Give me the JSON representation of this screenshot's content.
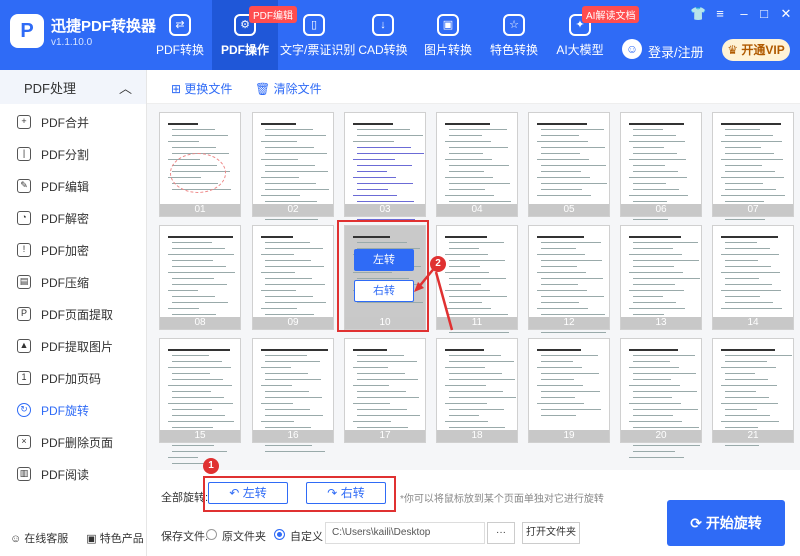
{
  "app": {
    "name": "迅捷PDF转换器",
    "version": "v1.1.10.0",
    "logo_letter": "P"
  },
  "nav": [
    {
      "label": "PDF转换",
      "icon": "convert-icon"
    },
    {
      "label": "PDF操作",
      "icon": "gear-icon",
      "badge": "PDF编辑"
    },
    {
      "label": "文字/票证识别",
      "icon": "book-icon"
    },
    {
      "label": "CAD转换",
      "icon": "download-icon"
    },
    {
      "label": "图片转换",
      "icon": "image-icon"
    },
    {
      "label": "特色转换",
      "icon": "star-icon"
    },
    {
      "label": "AI大模型",
      "icon": "ai-icon",
      "badge": "AI解读文档"
    }
  ],
  "user": {
    "login": "登录/注册",
    "vip": "开通VIP"
  },
  "sidebar": {
    "header": "PDF处理",
    "items": [
      "PDF合并",
      "PDF分割",
      "PDF编辑",
      "PDF解密",
      "PDF加密",
      "PDF压缩",
      "PDF页面提取",
      "PDF提取图片",
      "PDF加页码",
      "PDF旋转",
      "PDF删除页面",
      "PDF阅读"
    ],
    "active": "PDF旋转",
    "footer": [
      "在线客服",
      "特色产品"
    ]
  },
  "toolbar": {
    "replace": "更换文件",
    "clear": "清除文件"
  },
  "pages": [
    "01",
    "02",
    "03",
    "04",
    "05",
    "06",
    "07",
    "08",
    "09",
    "10",
    "11",
    "12",
    "13",
    "14",
    "15",
    "16",
    "17",
    "18",
    "19",
    "20",
    "21"
  ],
  "hover": {
    "left": "左转",
    "right": "右转",
    "step": "2"
  },
  "bottom": {
    "all_rotate_label": "全部旋转:",
    "left": "左转",
    "right": "右转",
    "step": "1",
    "hint": "*你可以将鼠标放到某个页面单独对它进行旋转",
    "save_label": "保存文件:",
    "opt_orig": "原文件夹",
    "opt_custom": "自定义",
    "path": "C:\\Users\\kaili\\Desktop",
    "dots": "···",
    "open_folder": "打开文件夹",
    "start": "开始旋转"
  },
  "colors": {
    "accent": "#2f6bf6",
    "highlight": "#e03131"
  }
}
